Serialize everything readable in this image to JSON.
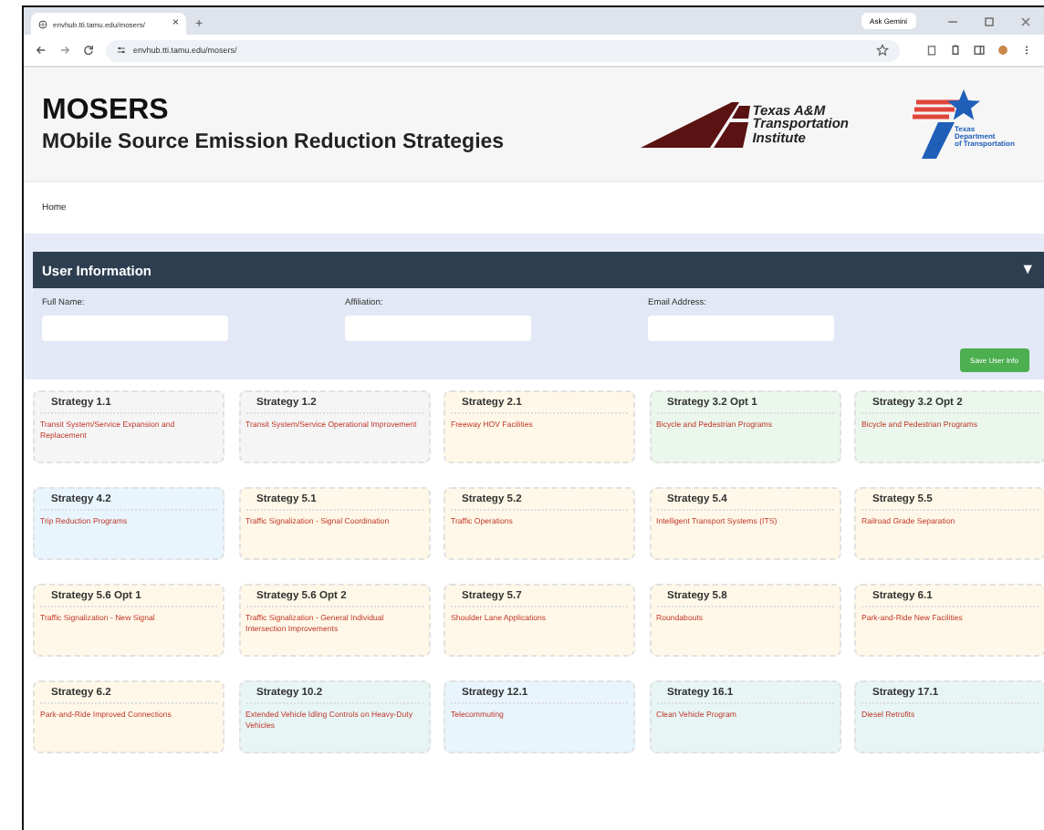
{
  "browser": {
    "tab_title": "envhub.tti.tamu.edu/mosers/",
    "tab_close": "×",
    "new_tab": "+",
    "ask": "Ask Gemini",
    "address": "envhub.tti.tamu.edu/mosers/"
  },
  "header": {
    "title": "MOSERS",
    "subtitle": "MObile Source Emission Reduction Strategies",
    "tti_logo": [
      "Texas A&M",
      "Transportation",
      "Institute"
    ],
    "txdot_logo": [
      "Texas",
      "Department",
      "of Transportation"
    ]
  },
  "nav": [
    "Home"
  ],
  "user_panel": {
    "title": "User Information",
    "toggle": "▼",
    "expanded": true,
    "fields": [
      {
        "label": "Full Name:"
      },
      {
        "label": "Affiliation:"
      },
      {
        "label": "Email Address:"
      }
    ],
    "button": "Save User Info"
  },
  "strategies": [
    {
      "title": "Strategy 1.1",
      "description": "Transit System/Service Expansion and Replacement",
      "color": "#f5f5f5"
    },
    {
      "title": "Strategy 1.2",
      "description": "Transit System/Service Operational Improvement",
      "color": "#f5f5f5"
    },
    {
      "title": "Strategy 2.1",
      "description": "Freeway HOV Facilities",
      "color": "#fff8e8"
    },
    {
      "title": "Strategy 3.2 Opt 1",
      "description": "Bicycle and Pedestrian Programs",
      "color": "#ebf6ec"
    },
    {
      "title": "Strategy 3.2 Opt 2",
      "description": "Bicycle and Pedestrian Programs",
      "color": "#ebf6ec"
    },
    {
      "title": "Strategy 4.2",
      "description": "Trip Reduction Programs",
      "color": "#e8f5fd"
    },
    {
      "title": "Strategy 5.1",
      "description": "Traffic Signalization - Signal Coordination",
      "color": "#fff8e8"
    },
    {
      "title": "Strategy 5.2",
      "description": "Traffic Operations",
      "color": "#fff8e8"
    },
    {
      "title": "Strategy 5.4",
      "description": "Intelligent Transport Systems (ITS)",
      "color": "#fff8e8"
    },
    {
      "title": "Strategy 5.5",
      "description": "Railroad Grade Separation",
      "color": "#fff8e8"
    },
    {
      "title": "Strategy 5.6 Opt 1",
      "description": "Traffic Signalization - New Signal",
      "color": "#fff8e8"
    },
    {
      "title": "Strategy 5.6 Opt 2",
      "description": "Traffic Signalization - General Individual Intersection Improvements",
      "color": "#fff8e8"
    },
    {
      "title": "Strategy 5.7",
      "description": "Shoulder Lane Applications",
      "color": "#fff8e8"
    },
    {
      "title": "Strategy 5.8",
      "description": "Roundabouts",
      "color": "#fff8e8"
    },
    {
      "title": "Strategy 6.1",
      "description": "Park-and-Ride New Facilities",
      "color": "#fff8e8"
    },
    {
      "title": "Strategy 6.2",
      "description": "Park-and-Ride Improved Connections",
      "color": "#fff8e8"
    },
    {
      "title": "Strategy 10.2",
      "description": "Extended Vehicle Idling Controls on Heavy-Duty Vehicles",
      "color": "#e7f5f5"
    },
    {
      "title": "Strategy 12.1",
      "description": "Telecommuting",
      "color": "#e8f5fd"
    },
    {
      "title": "Strategy 16.1",
      "description": "Clean Vehicle Program",
      "color": "#e7f5f5"
    },
    {
      "title": "Strategy 17.1",
      "description": "Diesel Retrofits",
      "color": "#e7f5f5"
    }
  ]
}
